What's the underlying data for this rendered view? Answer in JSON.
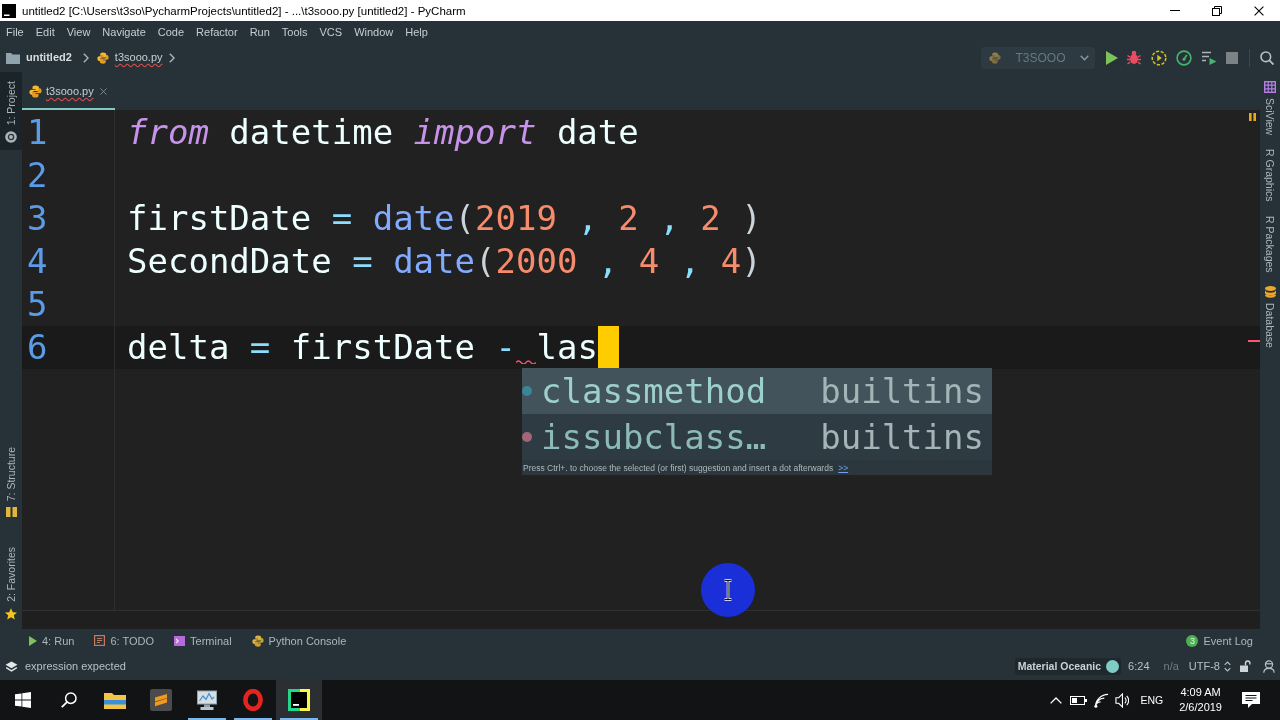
{
  "window": {
    "title": "untitled2 [C:\\Users\\t3so\\PycharmProjects\\untitled2] - ...\\t3sooo.py [untitled2] - PyCharm"
  },
  "menu": [
    "File",
    "Edit",
    "View",
    "Navigate",
    "Code",
    "Refactor",
    "Run",
    "Tools",
    "VCS",
    "Window",
    "Help"
  ],
  "breadcrumb": [
    {
      "label": "untitled2",
      "kind": "project",
      "misspelled": false
    },
    {
      "label": "t3sooo.py",
      "kind": "python-file",
      "misspelled": true
    }
  ],
  "run_toolbar": {
    "configuration": "T3SOOO"
  },
  "left_tool_tabs": [
    {
      "label": "1: Project",
      "kind": "project",
      "selected": true
    },
    {
      "label": "7: Structure",
      "kind": "structure",
      "selected": false
    },
    {
      "label": "2: Favorites",
      "kind": "favorites",
      "selected": false
    }
  ],
  "editor_tabs": [
    {
      "label": "t3sooo.py",
      "selected": true,
      "misspelled": true
    }
  ],
  "editor": {
    "lines": [
      {
        "number": "1",
        "current": false,
        "tokens": [
          {
            "text": "from",
            "kind": "keyword"
          },
          {
            "text": " datetime ",
            "kind": "name"
          },
          {
            "text": "import",
            "kind": "keyword"
          },
          {
            "text": " date",
            "kind": "name"
          }
        ]
      },
      {
        "number": "2",
        "current": false
      },
      {
        "number": "3",
        "current": false,
        "tokens": [
          {
            "text": "firstDate",
            "kind": "name"
          },
          {
            "text": " = ",
            "kind": "operator"
          },
          {
            "text": "date",
            "kind": "function"
          },
          {
            "text": "(",
            "kind": "bracket"
          },
          {
            "text": "2019",
            "kind": "number"
          },
          {
            "text": " , ",
            "kind": "punctuation"
          },
          {
            "text": "2",
            "kind": "number"
          },
          {
            "text": " , ",
            "kind": "punctuation"
          },
          {
            "text": "2",
            "kind": "number"
          },
          {
            "text": " )",
            "kind": "bracket"
          }
        ]
      },
      {
        "number": "4",
        "current": false,
        "tokens": [
          {
            "text": "SecondDate",
            "kind": "name"
          },
          {
            "text": " = ",
            "kind": "operator"
          },
          {
            "text": "date",
            "kind": "function"
          },
          {
            "text": "(",
            "kind": "bracket"
          },
          {
            "text": "2000",
            "kind": "number"
          },
          {
            "text": " , ",
            "kind": "punctuation"
          },
          {
            "text": "4",
            "kind": "number"
          },
          {
            "text": " , ",
            "kind": "punctuation"
          },
          {
            "text": "4",
            "kind": "number"
          },
          {
            "text": ")",
            "kind": "bracket"
          }
        ]
      },
      {
        "number": "5",
        "current": false
      },
      {
        "number": "6",
        "current": true,
        "tokens": [
          {
            "text": "delta",
            "kind": "name"
          },
          {
            "text": " = ",
            "kind": "operator"
          },
          {
            "text": "firstDate",
            "kind": "name"
          },
          {
            "text": " -",
            "kind": "operator"
          },
          {
            "text": " las",
            "kind": "error"
          }
        ]
      }
    ]
  },
  "completion_popup": {
    "items": [
      {
        "name": "classmethod",
        "source": "builtins",
        "kind": "class",
        "selected": true
      },
      {
        "name": "issubclass…",
        "source": "builtins",
        "kind": "function",
        "selected": false
      }
    ],
    "hint": "Press Ctrl+. to choose the selected (or first) suggestion and insert a dot afterwards",
    "hint_link": ">>"
  },
  "right_tool_tabs": [
    {
      "label": "SciView",
      "kind": "sciview",
      "selected": false
    },
    {
      "label": "R Graphics",
      "kind": "plain",
      "selected": false
    },
    {
      "label": "R Packages",
      "kind": "plain",
      "selected": false
    },
    {
      "label": "Database",
      "kind": "database",
      "selected": false
    }
  ],
  "tool_window_bar": {
    "tools": [
      {
        "label": "4: Run",
        "kind": "run"
      },
      {
        "label": "6: TODO",
        "kind": "todo"
      },
      {
        "label": "Terminal",
        "kind": "terminal"
      },
      {
        "label": "Python Console",
        "kind": "python-console"
      }
    ],
    "event_log": {
      "label": "Event Log",
      "count": "3"
    }
  },
  "status_bar": {
    "message": "expression expected",
    "theme": "Material Oceanic",
    "position": "6:24",
    "line_separator": "n/a",
    "encoding": "UTF-8"
  },
  "taskbar": {
    "apps": [
      {
        "kind": "file-explorer",
        "running": false,
        "selected": false
      },
      {
        "kind": "text-editor",
        "running": false,
        "selected": false
      },
      {
        "kind": "system-monitor",
        "running": true,
        "selected": false
      },
      {
        "kind": "web-browser",
        "running": true,
        "selected": false
      },
      {
        "kind": "python-ide",
        "running": true,
        "selected": true
      }
    ],
    "language": "ENG",
    "time": "4:09 AM",
    "date": "2/6/2019"
  }
}
